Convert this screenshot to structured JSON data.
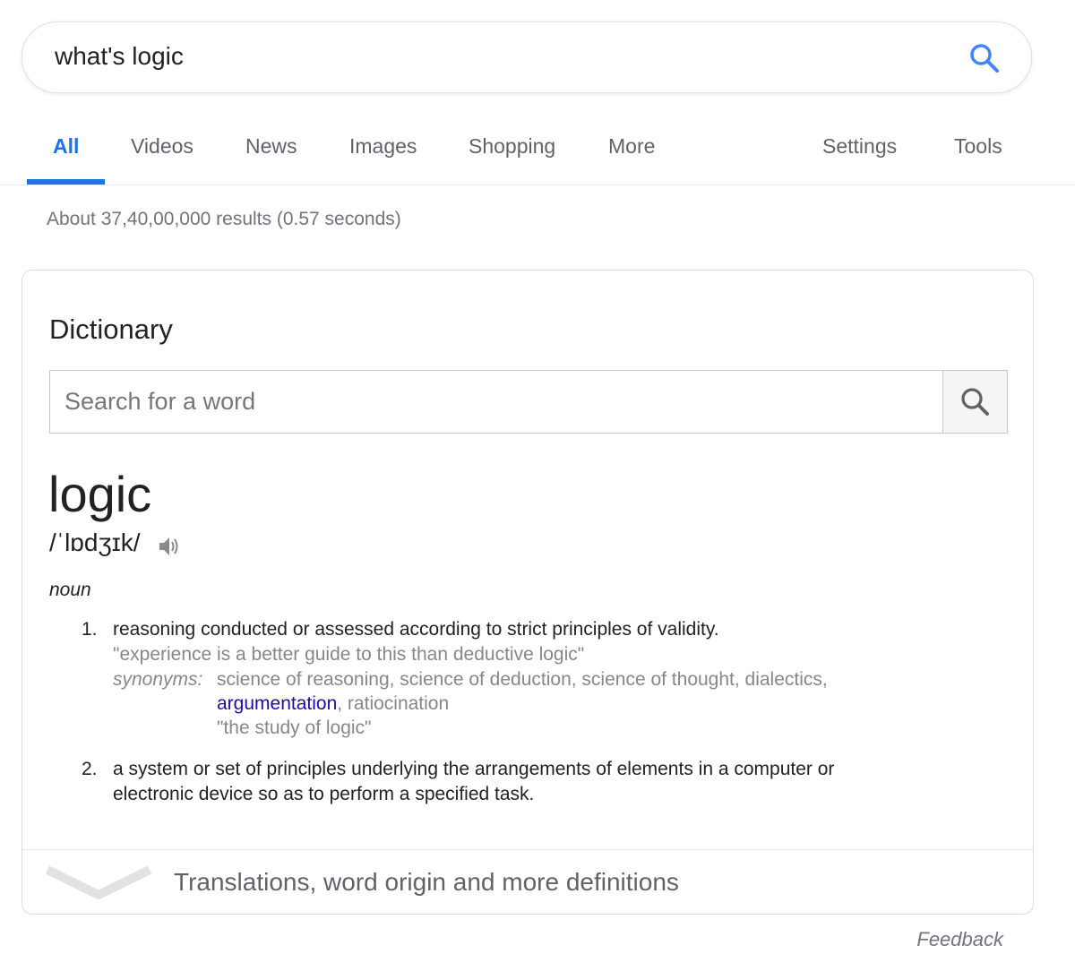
{
  "search": {
    "query": "what's logic"
  },
  "tabs": [
    {
      "label": "All"
    },
    {
      "label": "Videos"
    },
    {
      "label": "News"
    },
    {
      "label": "Images"
    },
    {
      "label": "Shopping"
    },
    {
      "label": "More"
    },
    {
      "label": "Settings"
    },
    {
      "label": "Tools"
    }
  ],
  "result_stats": "About 37,40,00,000 results (0.57 seconds)",
  "dictionary": {
    "title": "Dictionary",
    "search_placeholder": "Search for a word",
    "headword": "logic",
    "phonetic": "/ˈlɒdʒɪk/",
    "part_of_speech": "noun",
    "definitions": [
      {
        "number": "1.",
        "text": "reasoning conducted or assessed according to strict principles of validity.",
        "example": "\"experience is a better guide to this than deductive logic\"",
        "synonyms_label": "synonyms:",
        "synonyms_line1": "science of reasoning, science of deduction, science of thought, dialectics,",
        "synonyms_link": "argumentation",
        "synonyms_line2_rest": ", ratiocination",
        "synonyms_example": "\"the study of logic\""
      },
      {
        "number": "2.",
        "text_line1": "a system or set of principles underlying the arrangements of elements in a computer or",
        "text_line2": "electronic device so as to perform a specified task."
      }
    ],
    "more_label": "Translations, word origin and more definitions"
  },
  "feedback_label": "Feedback",
  "colors": {
    "accent_blue": "#1a73e8",
    "link_blue": "#1a0dab",
    "muted_gray": "#70757a"
  }
}
